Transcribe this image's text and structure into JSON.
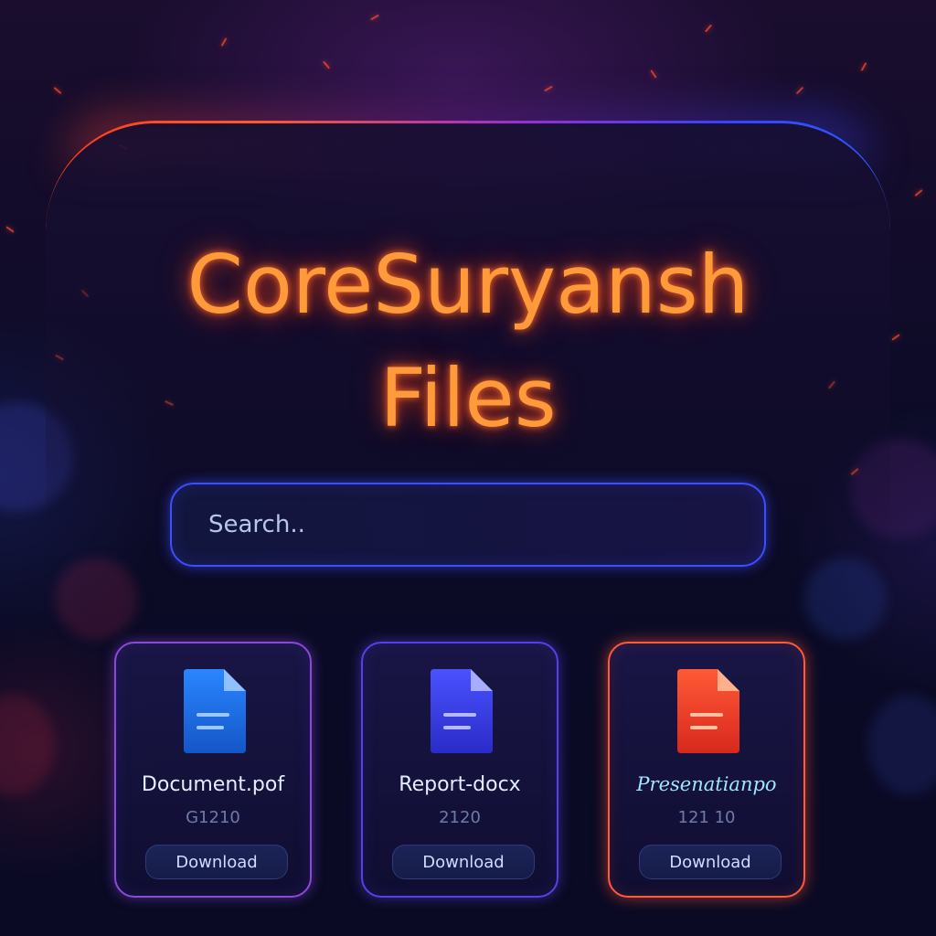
{
  "header": {
    "title_line1": "CoreSuryansh",
    "title_line2": "Files"
  },
  "search": {
    "placeholder": "Search..",
    "value": ""
  },
  "files": [
    {
      "name": "Document.pof",
      "size": "G1210",
      "download_label": "Download",
      "icon": "document-icon",
      "accent": "#1f6fe8"
    },
    {
      "name": "Report-docx",
      "size": "2120",
      "download_label": "Download",
      "icon": "document-icon",
      "accent": "#3a3fe0"
    },
    {
      "name": "Presenatianpo",
      "size": "121 10",
      "download_label": "Download",
      "icon": "document-icon",
      "accent": "#ff4a2a"
    }
  ],
  "colors": {
    "title_glow": "#ff9a3a",
    "search_border": "#3d4dff",
    "background": "#0b0a22"
  }
}
